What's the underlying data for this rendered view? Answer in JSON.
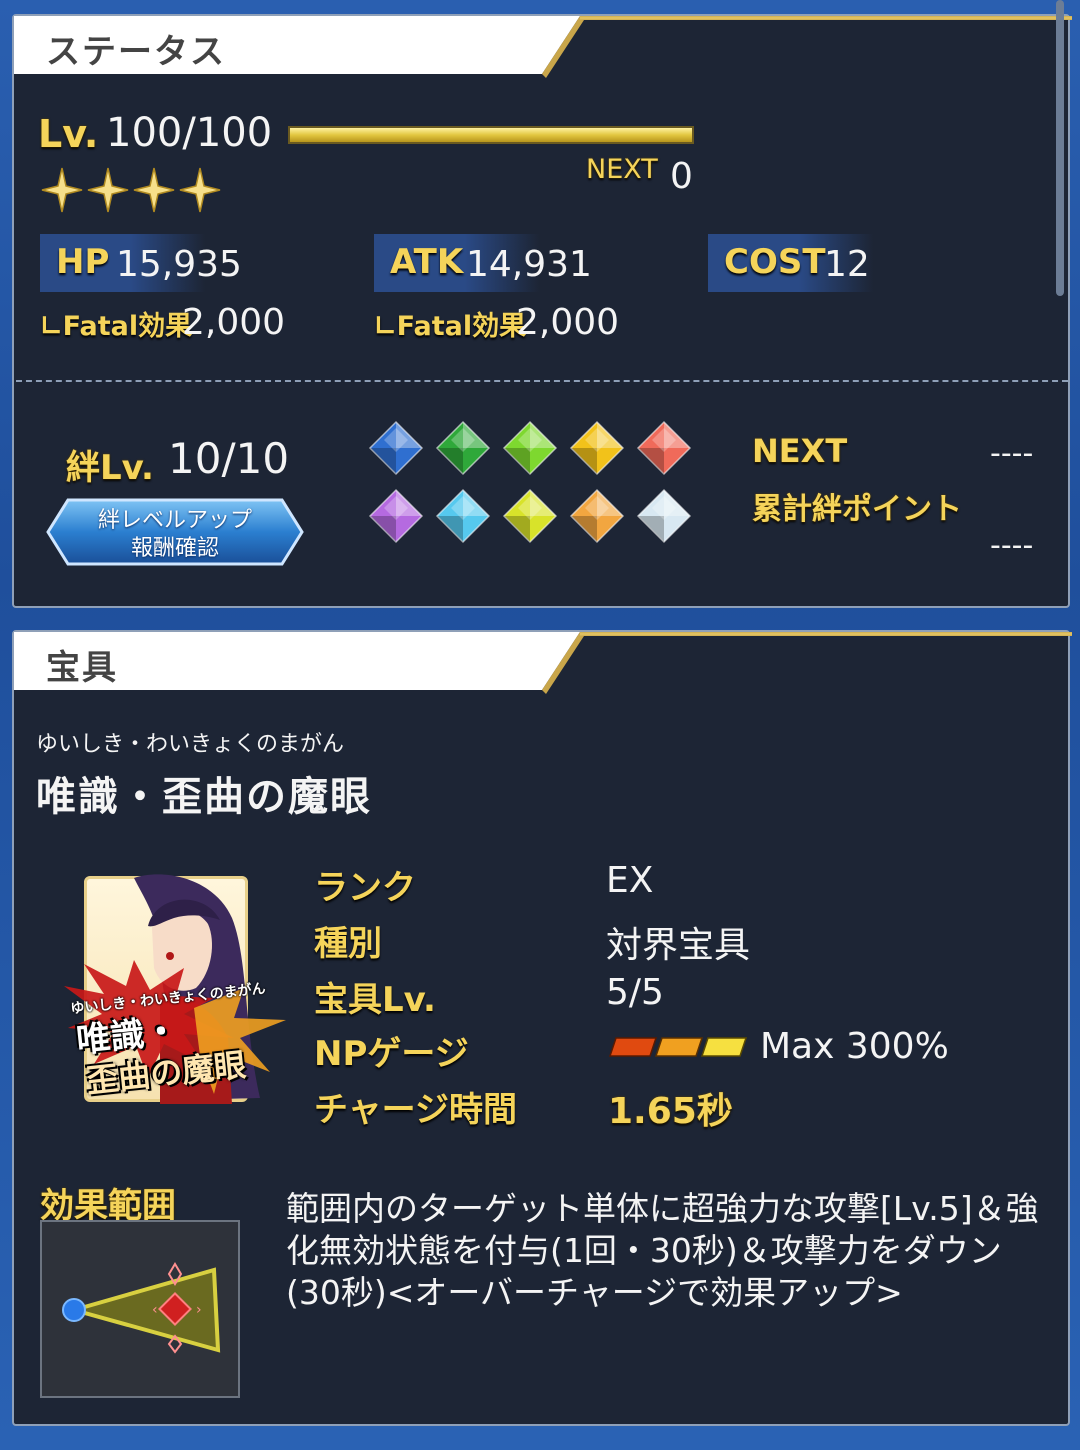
{
  "status": {
    "title": "ステータス",
    "level_label": "Lv.",
    "level_value": "100/100",
    "level_progress": 1.0,
    "next_label": "NEXT",
    "next_value": "0",
    "stars": 4,
    "hp_label": "HP",
    "hp_value": "15,935",
    "atk_label": "ATK",
    "atk_value": "14,931",
    "cost_label": "COST",
    "cost_value": "12",
    "hp_fatal_label": "∟Fatal効果",
    "hp_fatal_value": "2,000",
    "atk_fatal_label": "∟Fatal効果",
    "atk_fatal_value": "2,000",
    "bond_label": "絆Lv.",
    "bond_value": "10/10",
    "bond_button_line1": "絆レベルアップ",
    "bond_button_line2": "報酬確認",
    "bond_next_label": "NEXT",
    "bond_next_value": "----",
    "bond_total_label": "累計絆ポイント",
    "bond_total_value": "----",
    "gem_colors": [
      "#2f6fd0",
      "#2fa83a",
      "#7ed82f",
      "#f2c21a",
      "#f06a5a",
      "#b56ae0",
      "#56c9ee",
      "#d8e32a",
      "#f2a640",
      "#d8e8f2"
    ]
  },
  "np": {
    "title": "宝具",
    "ruby": "ゆいしき・わいきょくのまがん",
    "name": "唯識・歪曲の魔眼",
    "card_ruby": "ゆいしき・わいきょくのまがん",
    "card_line1": "唯識・",
    "card_line2": "歪曲の魔眼",
    "rank_label": "ランク",
    "rank_value": "EX",
    "type_label": "種別",
    "type_value": "対界宝具",
    "np_level_label": "宝具Lv.",
    "np_level_value": "5/5",
    "gauge_label": "NPゲージ",
    "gauge_value": "Max 300%",
    "charge_label": "チャージ時間",
    "charge_value": "1.65秒",
    "range_label": "効果範囲",
    "description": "範囲内のターゲット単体に超強力な攻撃[Lv.5]＆強化無効状態を付与(1回・30秒)＆攻撃力をダウン(30秒)<オーバーチャージで効果アップ>"
  }
}
